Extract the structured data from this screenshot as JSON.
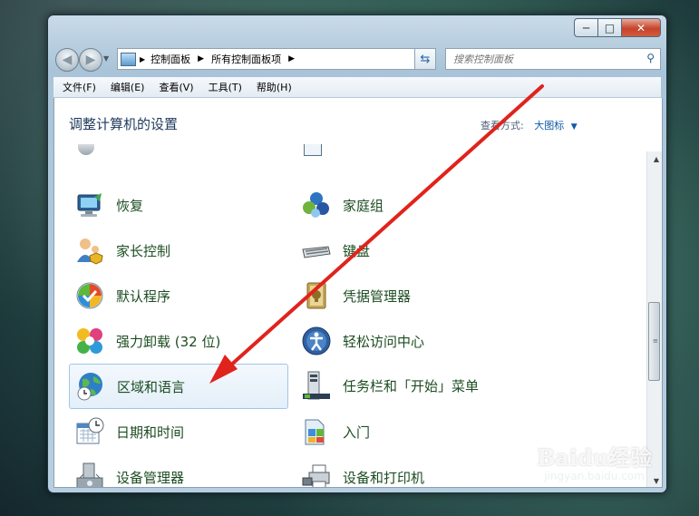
{
  "window": {
    "caption_buttons": [
      "─",
      "□",
      "✕"
    ]
  },
  "nav": {
    "back_icon": "back-arrow-icon",
    "forward_icon": "forward-arrow-icon",
    "breadcrumb": [
      "控制面板",
      "所有控制面板项"
    ],
    "separator": "▶",
    "refresh_icon": "refresh-icon",
    "search_placeholder": "搜索控制面板"
  },
  "menu": [
    "文件(F)",
    "编辑(E)",
    "查看(V)",
    "工具(T)",
    "帮助(H)"
  ],
  "header": {
    "title": "调整计算机的设置",
    "view_label": "查看方式:",
    "view_value": "大图标"
  },
  "items": [
    {
      "label": "恢复",
      "icon": "recovery-icon"
    },
    {
      "label": "家庭组",
      "icon": "homegroup-icon"
    },
    {
      "label": "家长控制",
      "icon": "parental-controls-icon"
    },
    {
      "label": "键盘",
      "icon": "keyboard-icon"
    },
    {
      "label": "默认程序",
      "icon": "default-programs-icon"
    },
    {
      "label": "凭据管理器",
      "icon": "credential-manager-icon"
    },
    {
      "label": "强力卸载 (32 位)",
      "icon": "uninstaller-icon"
    },
    {
      "label": "轻松访问中心",
      "icon": "ease-of-access-icon"
    },
    {
      "label": "区域和语言",
      "icon": "region-language-icon",
      "highlighted": true
    },
    {
      "label": "任务栏和「开始」菜单",
      "icon": "taskbar-icon"
    },
    {
      "label": "日期和时间",
      "icon": "date-time-icon"
    },
    {
      "label": "入门",
      "icon": "getting-started-icon"
    },
    {
      "label": "设备管理器",
      "icon": "device-manager-icon"
    },
    {
      "label": "设备和打印机",
      "icon": "devices-printers-icon"
    }
  ],
  "watermark": {
    "brand": "Baidu经验",
    "url": "jingyan.baidu.com"
  },
  "colors": {
    "title_text": "#1e395b",
    "item_text": "#1c4d22",
    "link_blue": "#0f5aa8",
    "annotation_arrow": "#e0231c"
  }
}
